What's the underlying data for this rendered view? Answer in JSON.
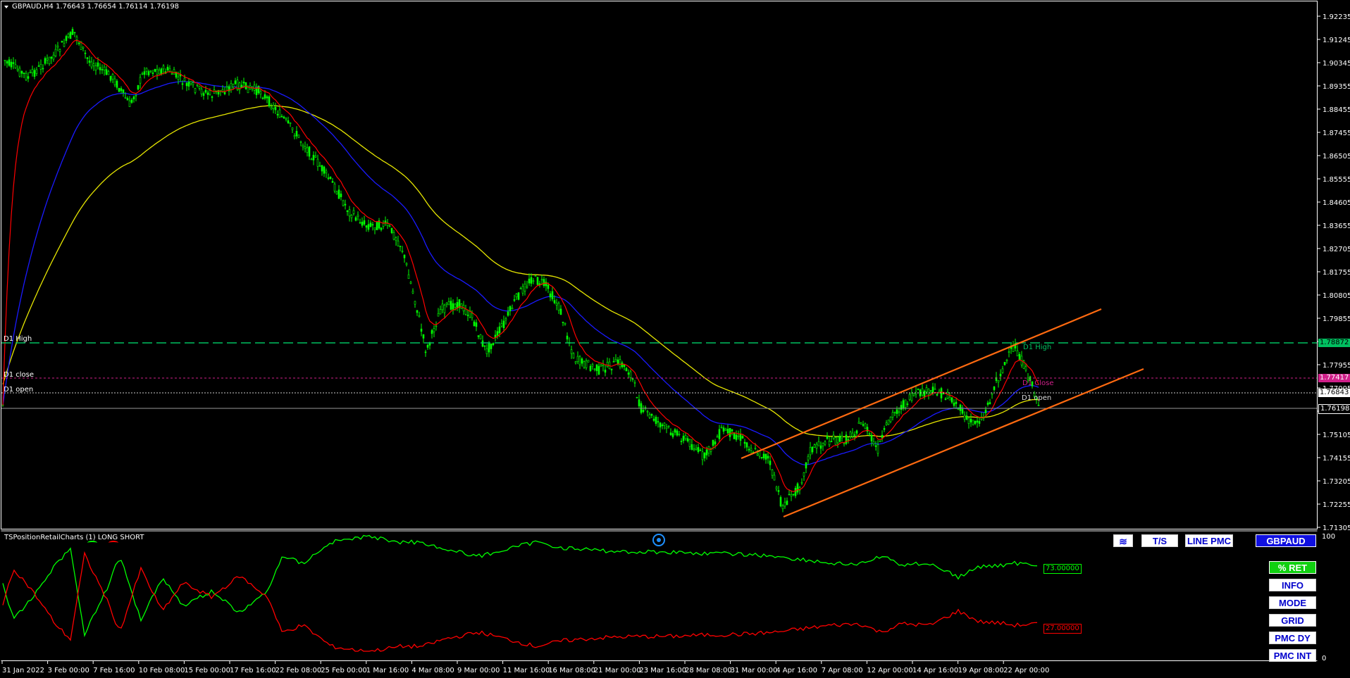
{
  "symbol_header": "GBPAUD,H4  1.76643 1.76654 1.76114 1.76198",
  "indicator_header": "TSPositionRetailCharts (1) LONG SHORT",
  "price_axis": [
    "1.92235",
    "1.91245",
    "1.90345",
    "1.89355",
    "1.88455",
    "1.87455",
    "1.86505",
    "1.85555",
    "1.84605",
    "1.83655",
    "1.82705",
    "1.81755",
    "1.80805",
    "1.79855",
    "1.78905",
    "1.77955",
    "1.77005",
    "1.76055",
    "1.75105",
    "1.74155",
    "1.73205",
    "1.72255",
    "1.71305"
  ],
  "time_axis": [
    "31 Jan 2022",
    "3 Feb 00:00",
    "7 Feb 16:00",
    "10 Feb 08:00",
    "15 Feb 00:00",
    "17 Feb 16:00",
    "22 Feb 08:00",
    "25 Feb 00:00",
    "1 Mar 16:00",
    "4 Mar 08:00",
    "9 Mar 00:00",
    "11 Mar 16:00",
    "16 Mar 08:00",
    "21 Mar 00:00",
    "23 Mar 16:00",
    "28 Mar 08:00",
    "31 Mar 00:00",
    "4 Apr 16:00",
    "7 Apr 08:00",
    "12 Apr 00:00",
    "14 Apr 16:00",
    "19 Apr 08:00",
    "22 Apr 00:00"
  ],
  "levels": {
    "d1_high_left": "D1 High",
    "d1_close_left": "D1 close",
    "d1_open_left": "D1 open",
    "d1_high_right": "D1 High",
    "d1_close_right": "D1 Close",
    "d1_open_right": "D1 open",
    "d1_high_value": "1.78872",
    "d1_close_value": "1.77417",
    "d1_open_value": "1.76843",
    "current_price": "1.76198"
  },
  "indicator": {
    "scale_max": "100",
    "scale_min": "0",
    "long_value": "73.00000",
    "short_value": "27.00000"
  },
  "buttons": {
    "wave": "≋",
    "ts": "T/S",
    "line_pmc": "LINE PMC",
    "symbol": "GBPAUD",
    "ret": "% RET",
    "info": "INFO",
    "mode": "MODE",
    "grid": "GRID",
    "pmc_dy": "PMC DY",
    "pmc_int": "PMC INT"
  },
  "colors": {
    "background": "#000000",
    "candle": "#00ff00",
    "ma_fast": "#ff0000",
    "ma_mid": "#1a1aff",
    "ma_slow": "#e6e600",
    "channel": "#ff6a10",
    "d1_high": "#00c060",
    "d1_close": "#d0208a",
    "long_line": "#00ff00",
    "short_line": "#ff0000"
  }
}
